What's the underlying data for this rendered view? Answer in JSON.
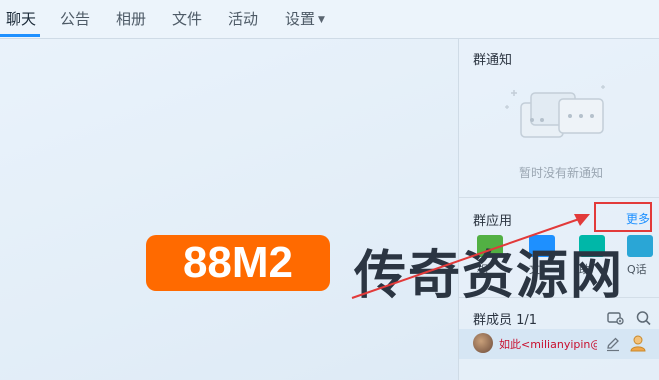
{
  "tabs": [
    {
      "label": "聊天"
    },
    {
      "label": "公告"
    },
    {
      "label": "相册"
    },
    {
      "label": "文件"
    },
    {
      "label": "活动"
    },
    {
      "label": "设置"
    }
  ],
  "notice": {
    "title": "群通知",
    "empty_text": "暂时没有新通知"
  },
  "apps": {
    "title": "群应用",
    "more_label": "更多",
    "items": [
      {
        "label": "相",
        "color": "#52b043",
        "icon": "photo-icon"
      },
      {
        "label": "文",
        "color": "#1e90ff",
        "icon": "file-icon"
      },
      {
        "label": "助",
        "color": "#00b7a8",
        "icon": "assistant-icon"
      },
      {
        "label": "Q话",
        "color": "#2aa6d6",
        "icon": "call-icon"
      }
    ]
  },
  "members": {
    "title": "群成员 1/1",
    "list": [
      {
        "name": "如此<milianyipin@q",
        "avatar": "user-avatar"
      }
    ]
  },
  "watermark": {
    "badge": "88M2",
    "text": "传奇资源网"
  },
  "colors": {
    "accent": "#1e90ff",
    "highlight_box": "#e23a3a",
    "watermark_orange": "#ff6a00",
    "member_name": "#c8102e"
  }
}
